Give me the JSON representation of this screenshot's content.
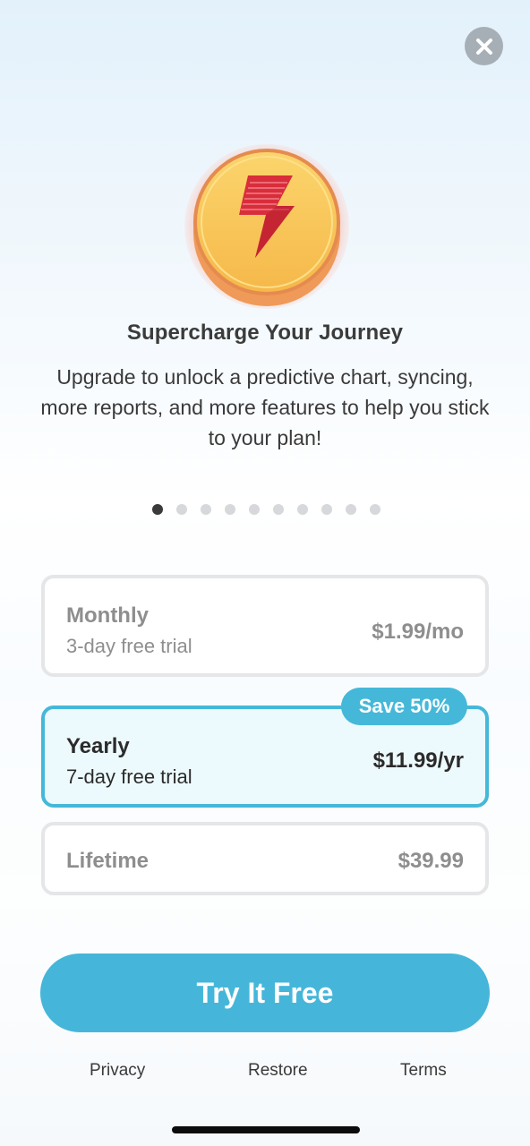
{
  "icons": {
    "close": "close-icon",
    "hero": "lightning-coin-icon"
  },
  "colors": {
    "accent": "#45b8d9",
    "selected_plan_bg": "#edfafd",
    "coin_gold": "#f7c04a",
    "bolt_red": "#d92d3b"
  },
  "header": {
    "title": "Supercharge Your Journey",
    "subtitle": "Upgrade to unlock a predictive chart, syncing, more reports, and more features to help you stick to your plan!"
  },
  "carousel": {
    "page_count": 10,
    "active_page": 1
  },
  "plans": {
    "monthly": {
      "name": "Monthly",
      "trial": "3-day free trial",
      "price": "$1.99/mo",
      "selected": false
    },
    "yearly": {
      "name": "Yearly",
      "trial": "7-day free trial",
      "price": "$11.99/yr",
      "badge": "Save 50%",
      "selected": true
    },
    "lifetime": {
      "name": "Lifetime",
      "price": "$39.99",
      "selected": false
    }
  },
  "cta": {
    "label": "Try It Free"
  },
  "footer": {
    "privacy": "Privacy",
    "restore": "Restore",
    "terms": "Terms"
  }
}
